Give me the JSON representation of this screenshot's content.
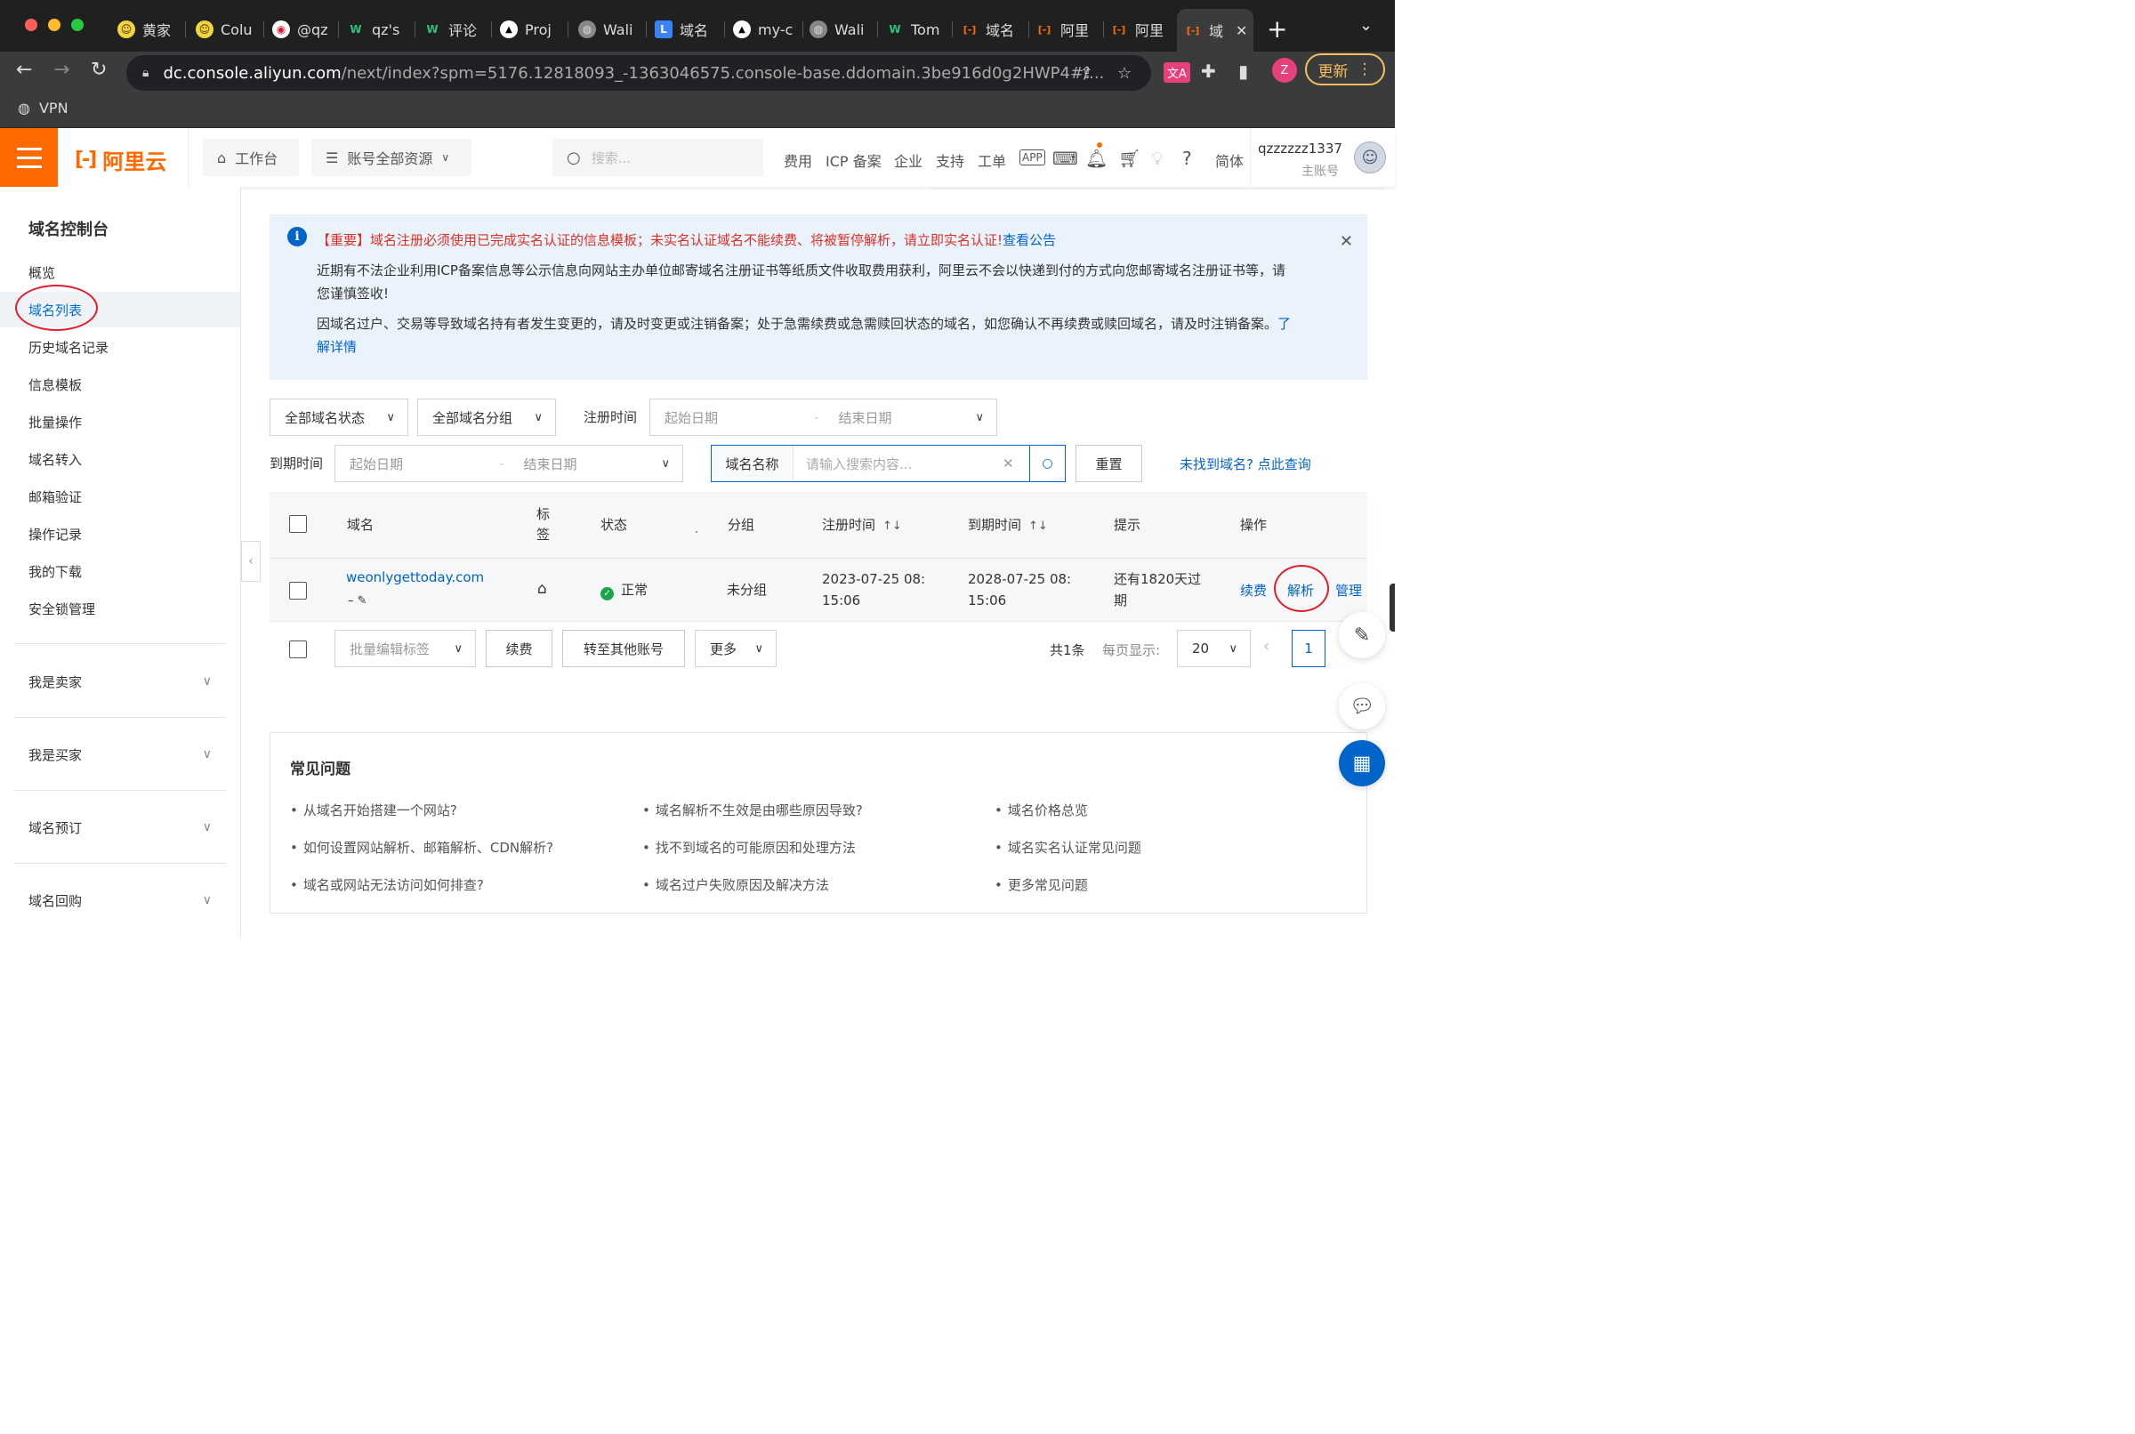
{
  "browser": {
    "tabs": [
      {
        "label": "黄家",
        "icon": "emoji-face-icon"
      },
      {
        "label": "Colu",
        "icon": "emoji-face-icon"
      },
      {
        "label": "@qz",
        "icon": "weibo-icon"
      },
      {
        "label": "qz's",
        "icon": "w-logo-icon"
      },
      {
        "label": "评论",
        "icon": "w-logo-icon"
      },
      {
        "label": "Proj",
        "icon": "vercel-icon"
      },
      {
        "label": "Wali",
        "icon": "globe-icon"
      },
      {
        "label": "域名",
        "icon": "l-logo-icon"
      },
      {
        "label": "my-c",
        "icon": "vercel-icon"
      },
      {
        "label": "Wali",
        "icon": "globe-icon"
      },
      {
        "label": "Tom",
        "icon": "w-logo-icon"
      },
      {
        "label": "域名",
        "icon": "aliyun-icon"
      },
      {
        "label": "阿里",
        "icon": "aliyun-icon"
      },
      {
        "label": "阿里",
        "icon": "aliyun-icon"
      },
      {
        "label": "域",
        "icon": "aliyun-icon"
      }
    ],
    "url_host": "dc.console.aliyun.com",
    "url_path": "/next/index?spm=5176.12818093_-1363046575.console-base.ddomain.3be916d0g2HWP4#/...",
    "profile_initial": "Z",
    "update_label": "更新",
    "bookmark": "VPN"
  },
  "topbar": {
    "logo_text": "阿里云",
    "workbench": "工作台",
    "resources": "账号全部资源",
    "search_placeholder": "搜索...",
    "links": [
      "费用",
      "ICP 备案",
      "企业",
      "支持",
      "工单"
    ],
    "lang": "简体",
    "username": "qzzzzzz1337",
    "account_type": "主账号"
  },
  "sidebar": {
    "title": "域名控制台",
    "items": [
      "概览",
      "域名列表",
      "历史域名记录",
      "信息模板",
      "批量操作",
      "域名转入",
      "邮箱验证",
      "操作记录",
      "我的下载",
      "安全锁管理"
    ],
    "groups": [
      "我是卖家",
      "我是买家",
      "域名预订",
      "域名回购"
    ]
  },
  "notice": {
    "important": "【重要】域名注册必须使用已完成实名认证的信息模板；未实名认证域名不能续费、将被暂停解析，请立即实名认证!",
    "important_link": "查看公告",
    "line2a": "近期有不法企业利用ICP备案信息等公示信息向网站主办单位邮寄域名注册证书等纸质文件收取费用获利，阿里云不会以快递到付的方式向您邮寄域名注册证书等，请",
    "line2b": "您谨慎签收!",
    "line3a": "因域名过户、交易等导致域名持有者发生变更的，请及时变更或注销备案；处于急需续费或急需赎回状态的域名，如您确认不再续费或赎回域名，请及时注销备案。",
    "line3_link_a": "了",
    "line3_link_b": "解详情"
  },
  "filters": {
    "status": "全部域名状态",
    "group": "全部域名分组",
    "reg_label": "注册时间",
    "exp_label": "到期时间",
    "start_placeholder": "起始日期",
    "end_placeholder": "结束日期",
    "search_prefix": "域名名称",
    "search_placeholder": "请输入搜索内容...",
    "reset": "重置",
    "not_found": "未找到域名? 点此查询"
  },
  "table": {
    "headers": {
      "domain": "域名",
      "tag": "标签",
      "status": "状态",
      "group": "分组",
      "reg": "注册时间",
      "exp": "到期时间",
      "tip": "提示",
      "ops": "操作"
    },
    "rows": [
      {
        "domain": "weonlygettoday.com",
        "remark": "–",
        "status": "正常",
        "group": "未分组",
        "reg_a": "2023-07-25 08:",
        "reg_b": "15:06",
        "exp_a": "2028-07-25 08:",
        "exp_b": "15:06",
        "tip_a": "还有1820天过",
        "tip_b": "期",
        "op_renew": "续费",
        "op_dns": "解析",
        "op_manage": "管理"
      }
    ]
  },
  "bulk": {
    "edit_tags": "批量编辑标签",
    "renew": "续费",
    "transfer": "转至其他账号",
    "more": "更多",
    "total": "共1条",
    "per_page_label": "每页显示:",
    "per_page": "20",
    "page": "1"
  },
  "faq": {
    "title": "常见问题",
    "col1": [
      "从域名开始搭建一个网站?",
      "如何设置网站解析、邮箱解析、CDN解析?",
      "域名或网站无法访问如何排查?"
    ],
    "col2": [
      "域名解析不生效是由哪些原因导致?",
      "找不到域名的可能原因和处理方法",
      "域名过户失败原因及解决方法"
    ],
    "col3": [
      "域名价格总览",
      "域名实名认证常见问题",
      "更多常见问题"
    ]
  },
  "colors": {
    "brand": "#ff6a00",
    "link": "#0064c8",
    "highlight": "#e0202a",
    "ok": "#1aa64a"
  }
}
